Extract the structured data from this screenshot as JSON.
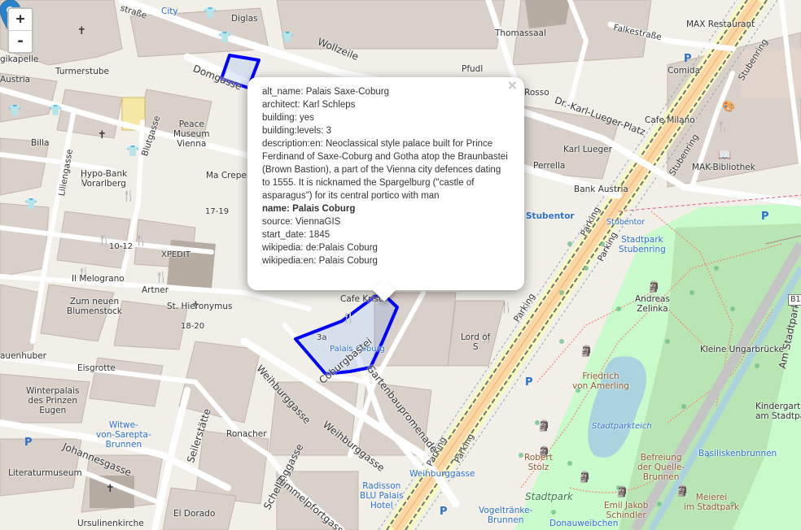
{
  "zoom": {
    "in_label": "+",
    "out_label": "-"
  },
  "popup": {
    "close_label": "×",
    "rows": [
      "alt_name: Palais Saxe-Coburg",
      "architect: Karl Schleps",
      "building: yes",
      "building:levels: 3",
      "description:en: Neoclassical style palace built for Prince Ferdinand of Saxe-Coburg and Gotha atop the Braunbastei (Brown Bastion), a part of the Vienna city defences dating to 1555. It is nicknamed the Spargelburg (\"castle of asparagus\") for its central portico with man",
      "name: Palais Coburg",
      "source: ViennaGIS",
      "start_date: 1845",
      "wikipedia: de:Palais Coburg",
      "wikipedia:en: Palais Coburg"
    ]
  },
  "labels": {
    "city": "City",
    "diglas": "Diglas",
    "strasse": "straße",
    "wollzeile": "Wollzeile",
    "thomassaal": "Thomassaal",
    "falkestrasse": "Falkestraße",
    "max_restaurant": "MAX Restaurant",
    "stubenring_top": "Stubenring",
    "comida": "Comida",
    "pfudl": "Pfudl",
    "kapelle": "gikapelle",
    "austria": "Austria",
    "turmerstube": "Turmerstube",
    "domgasse": "Domgasse",
    "rosso": "Rosso",
    "dr_karl_lueger_platz": "Dr.-Karl-Lueger-Platz",
    "cafe_milano": "Cafe Milano",
    "billa": "Billa",
    "blutgasse": "Blutgasse",
    "peace_museum": "Peace\nMuseum\nVienna",
    "karl_lueger": "Karl Lueger",
    "stubenring_right": "Stubenring",
    "liliengasse": "Liliengasse",
    "hypo_bank": "Hypo-Bank\nVorarlberg",
    "ma_creper": "Ma Creper",
    "perrella": "Perrella",
    "mak_bibliothek": "MAK-Bibliothek",
    "bank_austria": "Bank Austria",
    "stubentor": "Stubentor",
    "stubentor_stop": "Stubentor",
    "parking1": "Parking",
    "parking2": "Parking",
    "parking3": "Parking",
    "parking4": "Parking",
    "parking5": "Parking",
    "stadtpark_stubenring": "Stadtpark\nStubenring",
    "xpedit": "XPEDIT",
    "il_melograno": "Il Melograno",
    "zum_neuen_blumenstock": "Zum neuen\nBlumenstock",
    "artner": "Artner",
    "st_hieronymus": "St. Hieronymus",
    "cafe_krista": "Cafe Krista",
    "lord_of": "Lord of\nS",
    "andreas_zelinka": "Andreas\nZelinka",
    "kleine_ungarbruecke": "Kleine Ungarbrücke",
    "am_stadtpark_b1": "Am Stadtpark",
    "b1": "B1",
    "auenhuber": "auenhuber",
    "eisgrotte": "Eisgrotte",
    "palais_coburg": "Palais Coburg",
    "friedrich_von_amerling": "Friedrich\nvon Amerling",
    "winterpalais": "Winterpalais\ndes Prinzen\nEugen",
    "weihburggasse": "Weihburggasse",
    "weihburggasse2": "Weihburggasse",
    "coburgbastei": "Coburgbastei",
    "gartenbaupromenade": "Gartenbaupromenade",
    "seilerstaette": "Seilerstätte",
    "kindergarten": "Kindergart\nam Stadtpar",
    "witwe": "Witwe-\nvon-Sarepta-\nBrunnen",
    "ronacher": "Ronacher",
    "stadtparkteich": "Stadtparkteich",
    "johannesgasse": "Johannesgasse",
    "schellinggasse": "Schellinggasse",
    "weihburggasse_stop": "Weihburggasse",
    "robert_stolz": "Robert\nStolz",
    "befreiung": "Befreiung\nder Quelle-\nBrunnen",
    "basiliskenbrunnen": "Basiliskenbrunnen",
    "literaturmuseum": "Literaturmuseum",
    "himmelpfortgasse": "Himmelpfortgasse",
    "radisson": "Radisson\nBLU Palais\nHotel",
    "stadtpark": "Stadtpark",
    "ursulinenkirche": "Ursulinenkirche",
    "el_dorado": "El Dorado",
    "vogeltraenke": "Vogeltränke-\nBrunnen",
    "donauweibchen": "Donauweibchen",
    "emil_jakob_schindler": "Emil Jakob\nSchindler",
    "meierei": "Meierei\nim Stadtpark",
    "num_18_20": "18-20",
    "num_10_12": "10-12",
    "num_17_19": "17-19",
    "num_3a": "3a"
  }
}
